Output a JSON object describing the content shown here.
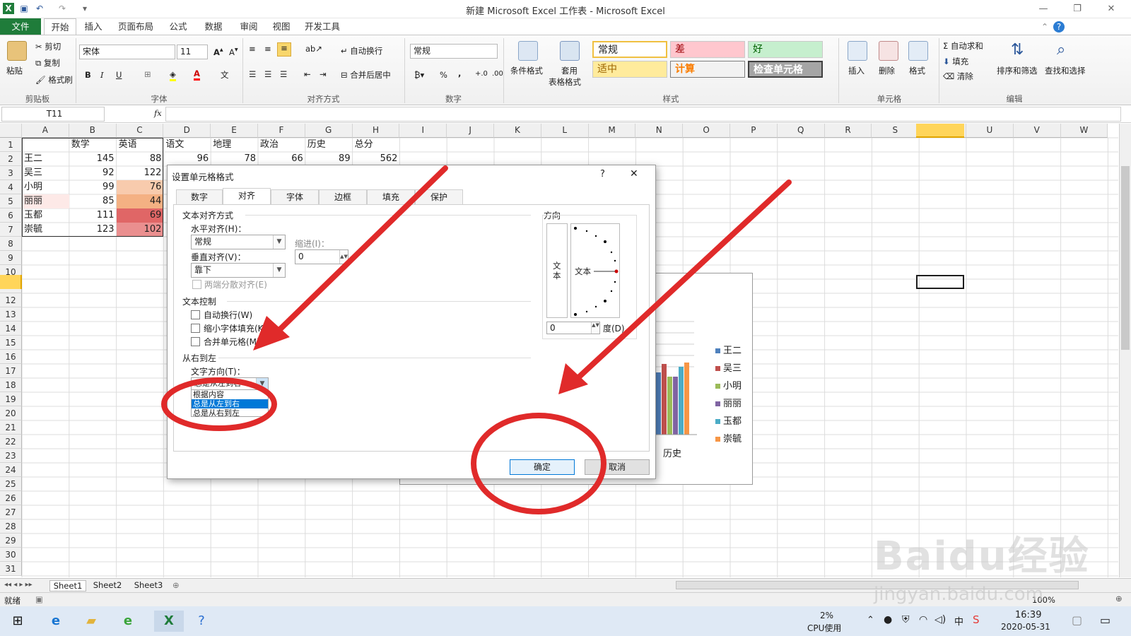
{
  "window": {
    "title": "新建 Microsoft Excel 工作表 - Microsoft Excel"
  },
  "ribbon_tabs": [
    "文件",
    "开始",
    "插入",
    "页面布局",
    "公式",
    "数据",
    "审阅",
    "视图",
    "开发工具"
  ],
  "clipboard": {
    "paste": "粘贴",
    "cut": "剪切",
    "copy": "复制",
    "format_painter": "格式刷",
    "group": "剪贴板"
  },
  "font": {
    "name": "宋体",
    "size": "11",
    "group": "字体",
    "bold": "B",
    "italic": "I",
    "underline": "U"
  },
  "alignment": {
    "wrap": "自动换行",
    "merge": "合并后居中",
    "group": "对齐方式"
  },
  "number": {
    "format": "常规",
    "group": "数字",
    "percent": "%",
    "comma": ","
  },
  "styles": {
    "conditional": "条件格式",
    "table_1": "套用",
    "table_2": "表格格式",
    "cells": [
      "常规",
      "差",
      "好",
      "适中",
      "计算",
      "检查单元格"
    ],
    "group": "样式"
  },
  "cells_group": {
    "insert": "插入",
    "delete": "删除",
    "format": "格式",
    "group": "单元格"
  },
  "editing": {
    "autosum": "自动求和",
    "fill": "填充",
    "clear": "清除",
    "sort": "排序和筛选",
    "find": "查找和选择",
    "group": "编辑"
  },
  "formula_bar": {
    "name_box": "T11",
    "fx": "fx"
  },
  "columns": [
    "A",
    "B",
    "C",
    "D",
    "E",
    "F",
    "G",
    "H",
    "I",
    "J",
    "K",
    "L",
    "M",
    "N",
    "O",
    "P",
    "Q",
    "R",
    "S",
    "T",
    "U",
    "V",
    "W"
  ],
  "rows": [
    "1",
    "2",
    "3",
    "4",
    "5",
    "6",
    "7",
    "8",
    "9",
    "10",
    "11",
    "12",
    "13",
    "14",
    "15",
    "16",
    "17",
    "18",
    "19",
    "20",
    "21",
    "22",
    "23",
    "24",
    "25",
    "26",
    "27",
    "28",
    "29",
    "30",
    "31"
  ],
  "sheet": {
    "headers": [
      "",
      "数学",
      "英语",
      "语文",
      "地理",
      "政治",
      "历史",
      "总分"
    ],
    "data": [
      [
        "王二",
        "145",
        "88",
        "96",
        "78",
        "66",
        "89",
        "562"
      ],
      [
        "吴三",
        "92",
        "122"
      ],
      [
        "小明",
        "99",
        "76"
      ],
      [
        "丽丽",
        "85",
        "44"
      ],
      [
        "玉都",
        "111",
        "69"
      ],
      [
        "崇毓",
        "123",
        "102"
      ]
    ]
  },
  "chart": {
    "x_label": "历史",
    "legend": [
      "王二",
      "吴三",
      "小明",
      "丽丽",
      "玉都",
      "崇毓"
    ],
    "colors": [
      "#4f81bd",
      "#c0504d",
      "#9bbb59",
      "#8064a2",
      "#4bacc6",
      "#f79646"
    ]
  },
  "dialog": {
    "title": "设置单元格格式",
    "help": "?",
    "close": "✕",
    "tabs": [
      "数字",
      "对齐",
      "字体",
      "边框",
      "填充",
      "保护"
    ],
    "text_alignment": "文本对齐方式",
    "horizontal_label": "水平对齐(H)：",
    "horizontal_value": "常规",
    "indent_label": "缩进(I)：",
    "indent_value": "0",
    "vertical_label": "垂直对齐(V)：",
    "vertical_value": "靠下",
    "distributed": "两端分散对齐(E)",
    "text_control": "文本控制",
    "wrap": "自动换行(W)",
    "shrink": "缩小字体填充(K)",
    "merge": "合并单元格(M)",
    "rtl": "从右到左",
    "direction_label": "文字方向(T)：",
    "direction_current": "总是从左到右",
    "direction_options": [
      "根据内容",
      "总是从左到右",
      "总是从右到左"
    ],
    "orientation": "方向",
    "vertical_text": "文本",
    "orient_text": "文本",
    "degree_value": "0",
    "degree_label": "度(D)",
    "ok": "确定",
    "cancel": "取消"
  },
  "sheet_tabs": [
    "Sheet1",
    "Sheet2",
    "Sheet3"
  ],
  "status": {
    "ready": "就绪",
    "zoom": "100%"
  },
  "watermark": {
    "brand": "Baidu经验",
    "url": "jingyan.baidu.com"
  },
  "taskbar": {
    "cpu_pct": "2%",
    "cpu_label": "CPU使用",
    "time": "16:39",
    "date": "2020-05-31",
    "ime": "中"
  }
}
